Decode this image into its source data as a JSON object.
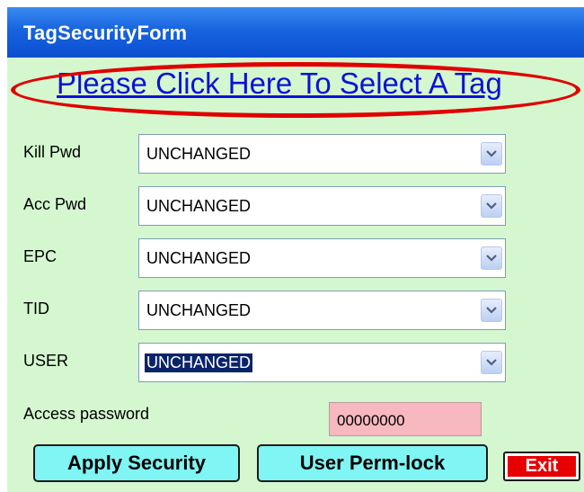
{
  "window": {
    "title": "TagSecurityForm"
  },
  "select_tag_link": "Please Click Here To Select A Tag",
  "rows": [
    {
      "label": "Kill Pwd",
      "value": "UNCHANGED"
    },
    {
      "label": "Acc Pwd",
      "value": "UNCHANGED"
    },
    {
      "label": "EPC",
      "value": "UNCHANGED"
    },
    {
      "label": "TID",
      "value": "UNCHANGED"
    },
    {
      "label": "USER",
      "value": "UNCHANGED",
      "selected": true
    }
  ],
  "access_password": {
    "label": "Access password",
    "value": "00000000"
  },
  "buttons": {
    "apply": "Apply Security",
    "perm_lock": "User Perm-lock",
    "exit": "Exit"
  },
  "colors": {
    "background": "#d4f7cf",
    "link": "#0c12d6",
    "highlight_ring": "#e00000",
    "button": "#7ff5f4",
    "password_field": "#f7b8c0",
    "exit": "#e80000"
  }
}
